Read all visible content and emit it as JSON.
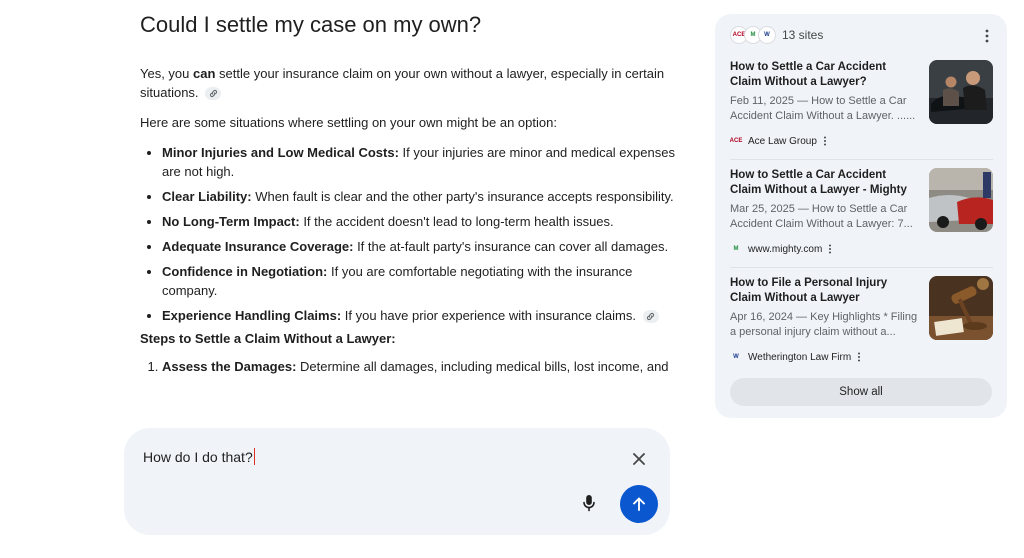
{
  "answer": {
    "heading": "Could I settle my case on my own?",
    "intro": {
      "before": "Yes, you ",
      "bold": "can",
      "after": " settle your insurance claim on your own without a lawyer, especially in certain situations."
    },
    "situations_intro": "Here are some situations where settling on your own might be an option:",
    "bullets": [
      {
        "bold": "Minor Injuries and Low Medical Costs:",
        "text": " If your injuries are minor and medical expenses are not high."
      },
      {
        "bold": "Clear Liability:",
        "text": " When fault is clear and the other party's insurance accepts responsibility."
      },
      {
        "bold": "No Long-Term Impact:",
        "text": " If the accident doesn't lead to long-term health issues."
      },
      {
        "bold": "Adequate Insurance Coverage:",
        "text": " If the at-fault party's insurance can cover all damages."
      },
      {
        "bold": "Confidence in Negotiation:",
        "text": " If you are comfortable negotiating with the insurance company."
      },
      {
        "bold": "Experience Handling Claims:",
        "text": " If you have prior experience with insurance claims."
      }
    ],
    "steps_title": "Steps to Settle a Claim Without a Lawyer:",
    "steps": [
      {
        "bold": "Assess the Damages:",
        "text": " Determine all damages, including medical bills, lost income, and"
      }
    ]
  },
  "composer": {
    "value": "How do I do that?",
    "accent": "#0b57d0"
  },
  "sources_panel": {
    "count_label": "13 sites",
    "favicons": [
      "ACE",
      "M",
      "W"
    ],
    "cards": [
      {
        "title": "How to Settle a Car Accident Claim Without a Lawyer?",
        "snippet": "Feb 11, 2025 — How to Settle a Car Accident Claim Without a Lawyer. ......",
        "source": "Ace Law Group",
        "favicon": "ACE",
        "thumb_icon": "people-at-car-photo"
      },
      {
        "title": "How to Settle a Car Accident Claim Without a Lawyer - Mighty",
        "snippet": "Mar 25, 2025 — How to Settle a Car Accident Claim Without a Lawyer: 7...",
        "source": "www.mighty.com",
        "favicon": "M",
        "thumb_icon": "car-crash-photo"
      },
      {
        "title": "How to File a Personal Injury Claim Without a Lawyer",
        "snippet": "Apr 16, 2024 — Key Highlights * Filing a personal injury claim without a...",
        "source": "Wetherington Law Firm",
        "favicon": "W",
        "thumb_icon": "gavel-photo"
      }
    ],
    "show_all_label": "Show all"
  }
}
